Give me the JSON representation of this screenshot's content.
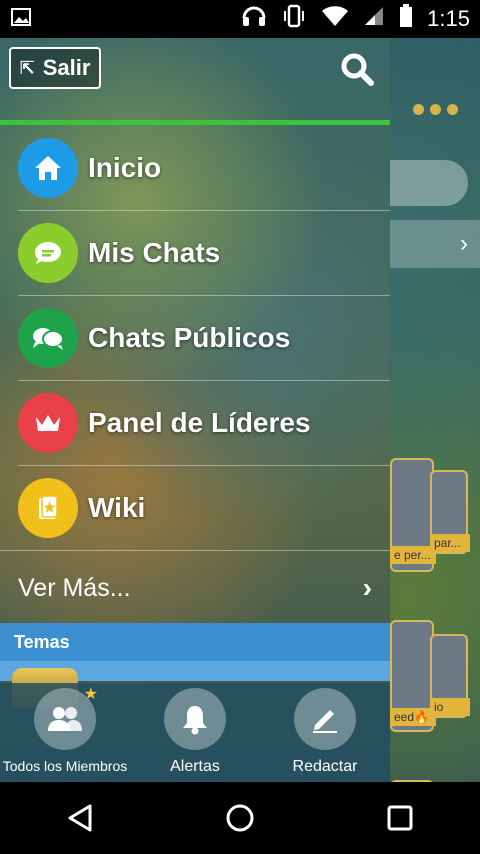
{
  "status_bar": {
    "time": "1:15",
    "icons": [
      "image-icon",
      "headphones-icon",
      "vibrate-icon",
      "wifi-icon",
      "signal-icon",
      "battery-icon"
    ]
  },
  "drawer": {
    "exit_label": "Salir",
    "menu": [
      {
        "label": "Inicio",
        "icon": "home-icon",
        "color": "#1e9be6"
      },
      {
        "label": "Mis Chats",
        "icon": "chat-bubble-icon",
        "color": "#8ccd2e"
      },
      {
        "label": "Chats Públicos",
        "icon": "group-chat-icon",
        "color": "#1fa34a"
      },
      {
        "label": "Panel de Líderes",
        "icon": "crown-icon",
        "color": "#e8414a"
      },
      {
        "label": "Wiki",
        "icon": "wiki-star-icon",
        "color": "#f2c01b"
      }
    ],
    "more_label": "Ver Más...",
    "topics_label": "Temas",
    "bottom_actions": [
      {
        "label": "Todos los Miembros",
        "icon": "members-icon"
      },
      {
        "label": "Alertas",
        "icon": "bell-icon"
      },
      {
        "label": "Redactar",
        "icon": "pencil-icon"
      }
    ]
  },
  "background": {
    "captions": [
      "e per...",
      "par...",
      "eed🔥",
      "io"
    ]
  },
  "colors": {
    "accent_green": "#39c53a",
    "topics_blue": "#3b8fd1",
    "menu_dots": "#d8b24a"
  }
}
